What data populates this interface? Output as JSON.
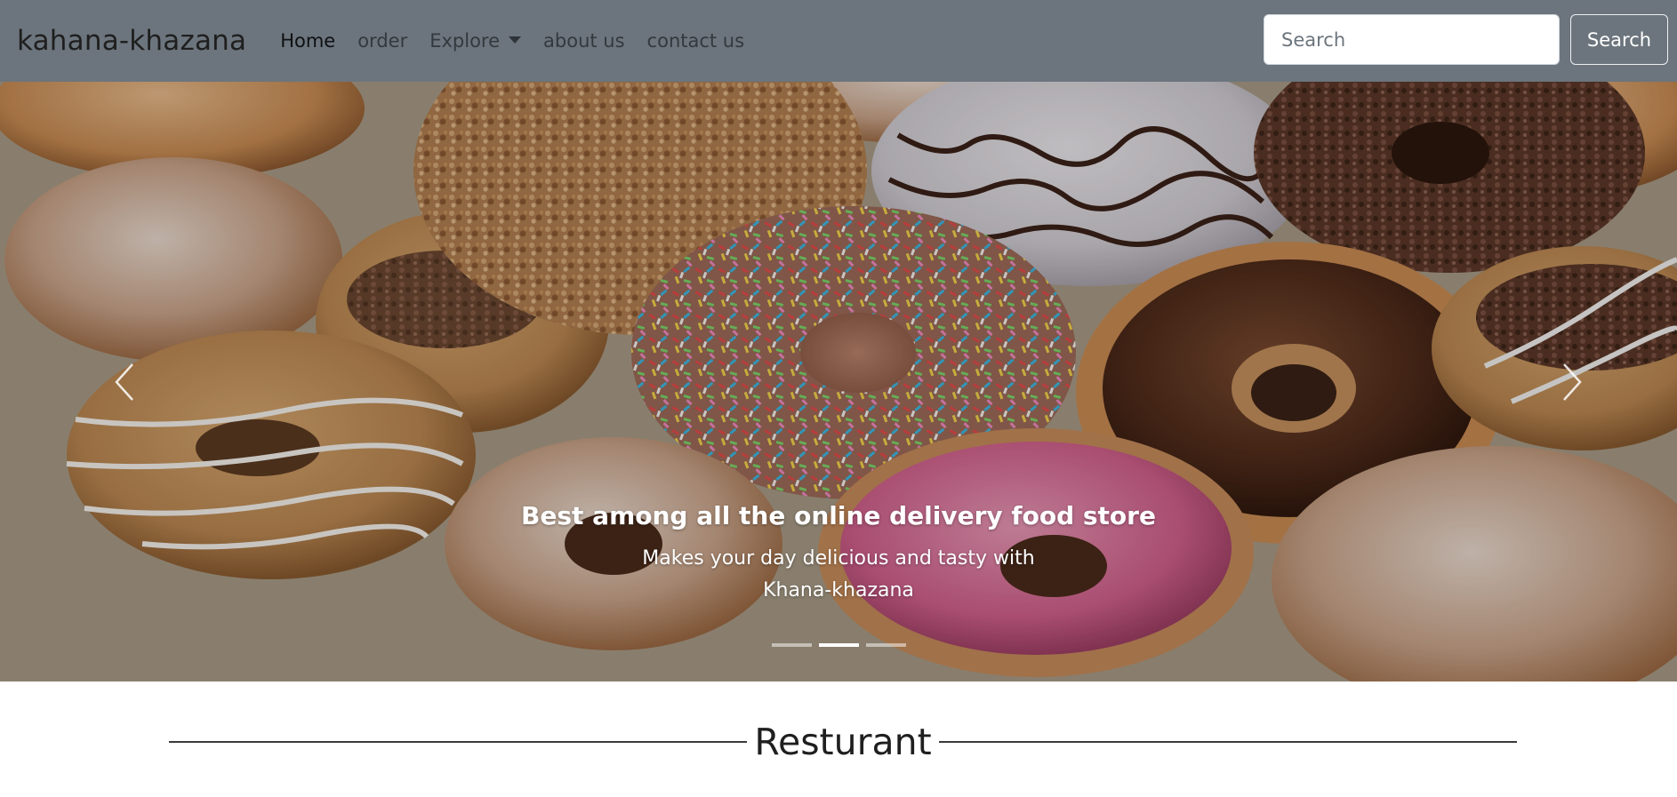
{
  "navbar": {
    "brand": "kahana-khazana",
    "links": [
      {
        "label": "Home",
        "active": true
      },
      {
        "label": "order",
        "active": false
      },
      {
        "label": "Explore",
        "active": false,
        "dropdown": true
      },
      {
        "label": "about us",
        "active": false
      },
      {
        "label": "contact us",
        "active": false
      }
    ],
    "search": {
      "placeholder": "Search",
      "button_label": "Search"
    }
  },
  "carousel": {
    "caption_title": "Best among all the online delivery food store",
    "caption_text": "Makes your day delicious and tasty with Khana-khazana",
    "slide_count": 3,
    "active_slide": 2,
    "prev_icon": "chevron-left-icon",
    "next_icon": "chevron-right-icon"
  },
  "section": {
    "title": "Resturant"
  },
  "colors": {
    "navbar_bg": "#6c757d",
    "accent_white": "#ffffff"
  }
}
